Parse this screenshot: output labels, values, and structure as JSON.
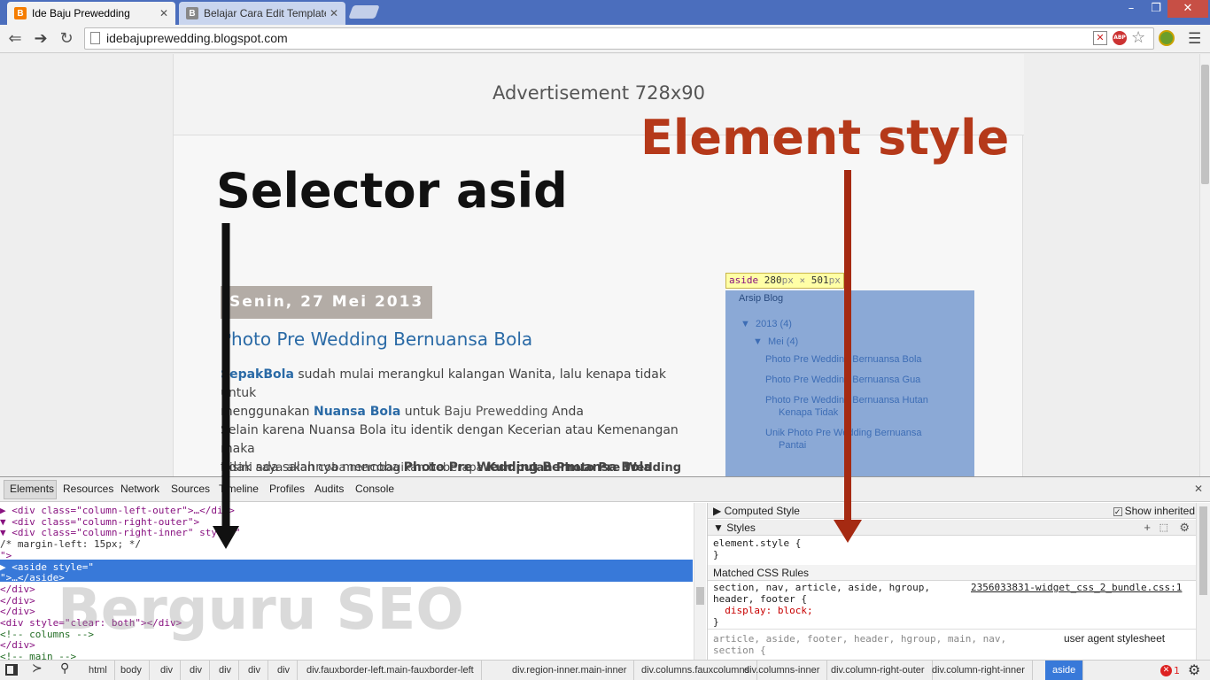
{
  "browser": {
    "tabs": [
      {
        "title": "Ide Baju Prewedding",
        "favicon": "blogger-icon",
        "active": true
      },
      {
        "title": "Belajar Cara Edit Template",
        "favicon": "b-icon",
        "active": false
      }
    ],
    "window_controls": {
      "minimize": "–",
      "restore": "❐",
      "close": "✕"
    },
    "url": "idebajuprewedding.blogspot.com",
    "toolbar_icons": [
      "back-icon",
      "forward-icon",
      "reload-icon",
      "page-icon",
      "block-icon",
      "adblock-icon",
      "star-icon",
      "extension-icon",
      "menu-icon"
    ],
    "adblock_label": "ABP"
  },
  "page": {
    "ad_text": "Advertisement 728x90",
    "post_date": "Senin, 27 Mei 2013",
    "post_title": "Photo Pre Wedding Bernuansa Bola",
    "body": {
      "l1a": "SepakBola",
      "l1b": " sudah mulai merangkul kalangan Wanita, lalu kenapa tidak untuk",
      "l2a": "menggunakan ",
      "l2b": "Nuansa Bola",
      "l2c": " untuk ",
      "l2d": "Baju Prewedding",
      "l2e": " Anda",
      "l3": "Selain karena Nuansa Bola itu identik dengan Kecerian atau Kemenangan maka",
      "l4a": "tidak ada salahnya mencoba ",
      "l4b": "Photo Pre Wedding Bernuansa Bola",
      "l5a": "Disini saya akan coba membagikan beberapa ",
      "l5b": "Kumpulan Photo Pre Wedding Bernuansa"
    },
    "aside_tip": {
      "tag": "aside",
      "w": "280",
      "h": "501",
      "unit": "px",
      "times": "×"
    },
    "aside": {
      "heading": "Arsip Blog",
      "year": "▼  2013 (4)",
      "month": "▼  Mei (4)",
      "links": [
        "Photo Pre Wedding Bernuansa Bola",
        "Photo Pre Wedding Bernuansa Gua",
        "Photo Pre Wedding Bernuansa Hutan",
        "Kenapa Tidak",
        "Unik Photo Pre Wedding Bernuansa",
        "Pantai"
      ]
    }
  },
  "annotations": {
    "selector_label": "Selector asid",
    "element_label": "Element style",
    "watermark": "Berguru SEO",
    "selector_color": "#111111",
    "element_color": "#b5391a"
  },
  "devtools": {
    "tabs": [
      "Elements",
      "Resources",
      "Network",
      "Sources",
      "Timeline",
      "Profiles",
      "Audits",
      "Console"
    ],
    "close": "✕",
    "dom": [
      {
        "i": "          ",
        "t": "▶ <div class=\"column-left-outer\">…</div>"
      },
      {
        "i": "          ",
        "t": "▼ <div class=\"column-right-outer\">"
      },
      {
        "i": "            ",
        "t": "▼ <div class=\"column-right-inner\" style=\""
      },
      {
        "i": "                ",
        "t": "/* margin-left: 15px; */"
      },
      {
        "i": "             ",
        "t": "\">"
      },
      {
        "i": "              ",
        "t": "▶ <aside style=\""
      },
      {
        "i": "               ",
        "t": "\">…</aside>"
      },
      {
        "i": "              ",
        "t": "</div>"
      },
      {
        "i": "            ",
        "t": "</div>"
      },
      {
        "i": "          ",
        "t": "</div>"
      },
      {
        "i": "          ",
        "t": "<div style=\"clear: both\"></div>"
      },
      {
        "i": "          ",
        "t": "<!-- columns -->"
      },
      {
        "i": "        ",
        "t": "</div>"
      },
      {
        "i": "        ",
        "t": "<!-- main -->"
      }
    ],
    "styles": {
      "computed_header": "▶  Computed Style",
      "show_inherited": "Show inherited",
      "styles_header": "▼  Styles",
      "element_style_open": "element.style {",
      "element_style_close": "}",
      "matched_header": "Matched CSS Rules",
      "rule1_sel": "section, nav, article, aside, hgroup,",
      "rule1_src": "2356033831-widget_css_2_bundle.css:1",
      "rule1_sel2": "header, footer {",
      "rule1_prop": "  display: block;",
      "rule1_close": "}",
      "rule2_sel": "article, aside, footer, header, hgroup, main, nav,",
      "rule2_src": "user agent stylesheet",
      "rule2_sel2": "section {"
    },
    "breadcrumbs": [
      "html",
      "body",
      "div",
      "div",
      "div",
      "div",
      "div",
      "div.fauxborder-left.main-fauxborder-left",
      "div.region-inner.main-inner",
      "div.columns.fauxcolumns",
      "div.columns-inner",
      "div.column-right-outer",
      "div.column-right-inner",
      "aside"
    ],
    "error_count": "1"
  }
}
